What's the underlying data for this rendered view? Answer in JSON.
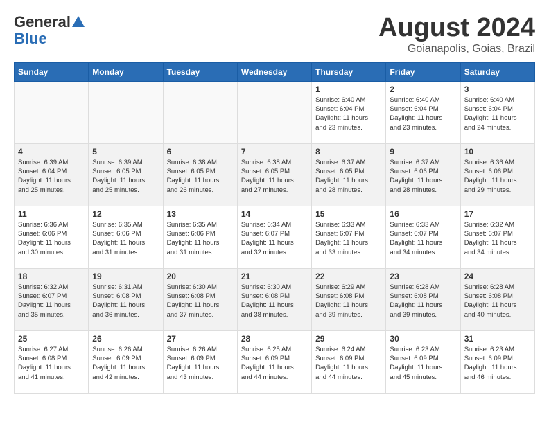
{
  "header": {
    "logo_general": "General",
    "logo_blue": "Blue",
    "month_year": "August 2024",
    "location": "Goianapolis, Goias, Brazil"
  },
  "weekdays": [
    "Sunday",
    "Monday",
    "Tuesday",
    "Wednesday",
    "Thursday",
    "Friday",
    "Saturday"
  ],
  "weeks": [
    [
      {
        "day": "",
        "info": ""
      },
      {
        "day": "",
        "info": ""
      },
      {
        "day": "",
        "info": ""
      },
      {
        "day": "",
        "info": ""
      },
      {
        "day": "1",
        "info": "Sunrise: 6:40 AM\nSunset: 6:04 PM\nDaylight: 11 hours\nand 23 minutes."
      },
      {
        "day": "2",
        "info": "Sunrise: 6:40 AM\nSunset: 6:04 PM\nDaylight: 11 hours\nand 23 minutes."
      },
      {
        "day": "3",
        "info": "Sunrise: 6:40 AM\nSunset: 6:04 PM\nDaylight: 11 hours\nand 24 minutes."
      }
    ],
    [
      {
        "day": "4",
        "info": "Sunrise: 6:39 AM\nSunset: 6:04 PM\nDaylight: 11 hours\nand 25 minutes."
      },
      {
        "day": "5",
        "info": "Sunrise: 6:39 AM\nSunset: 6:05 PM\nDaylight: 11 hours\nand 25 minutes."
      },
      {
        "day": "6",
        "info": "Sunrise: 6:38 AM\nSunset: 6:05 PM\nDaylight: 11 hours\nand 26 minutes."
      },
      {
        "day": "7",
        "info": "Sunrise: 6:38 AM\nSunset: 6:05 PM\nDaylight: 11 hours\nand 27 minutes."
      },
      {
        "day": "8",
        "info": "Sunrise: 6:37 AM\nSunset: 6:05 PM\nDaylight: 11 hours\nand 28 minutes."
      },
      {
        "day": "9",
        "info": "Sunrise: 6:37 AM\nSunset: 6:06 PM\nDaylight: 11 hours\nand 28 minutes."
      },
      {
        "day": "10",
        "info": "Sunrise: 6:36 AM\nSunset: 6:06 PM\nDaylight: 11 hours\nand 29 minutes."
      }
    ],
    [
      {
        "day": "11",
        "info": "Sunrise: 6:36 AM\nSunset: 6:06 PM\nDaylight: 11 hours\nand 30 minutes."
      },
      {
        "day": "12",
        "info": "Sunrise: 6:35 AM\nSunset: 6:06 PM\nDaylight: 11 hours\nand 31 minutes."
      },
      {
        "day": "13",
        "info": "Sunrise: 6:35 AM\nSunset: 6:06 PM\nDaylight: 11 hours\nand 31 minutes."
      },
      {
        "day": "14",
        "info": "Sunrise: 6:34 AM\nSunset: 6:07 PM\nDaylight: 11 hours\nand 32 minutes."
      },
      {
        "day": "15",
        "info": "Sunrise: 6:33 AM\nSunset: 6:07 PM\nDaylight: 11 hours\nand 33 minutes."
      },
      {
        "day": "16",
        "info": "Sunrise: 6:33 AM\nSunset: 6:07 PM\nDaylight: 11 hours\nand 34 minutes."
      },
      {
        "day": "17",
        "info": "Sunrise: 6:32 AM\nSunset: 6:07 PM\nDaylight: 11 hours\nand 34 minutes."
      }
    ],
    [
      {
        "day": "18",
        "info": "Sunrise: 6:32 AM\nSunset: 6:07 PM\nDaylight: 11 hours\nand 35 minutes."
      },
      {
        "day": "19",
        "info": "Sunrise: 6:31 AM\nSunset: 6:08 PM\nDaylight: 11 hours\nand 36 minutes."
      },
      {
        "day": "20",
        "info": "Sunrise: 6:30 AM\nSunset: 6:08 PM\nDaylight: 11 hours\nand 37 minutes."
      },
      {
        "day": "21",
        "info": "Sunrise: 6:30 AM\nSunset: 6:08 PM\nDaylight: 11 hours\nand 38 minutes."
      },
      {
        "day": "22",
        "info": "Sunrise: 6:29 AM\nSunset: 6:08 PM\nDaylight: 11 hours\nand 39 minutes."
      },
      {
        "day": "23",
        "info": "Sunrise: 6:28 AM\nSunset: 6:08 PM\nDaylight: 11 hours\nand 39 minutes."
      },
      {
        "day": "24",
        "info": "Sunrise: 6:28 AM\nSunset: 6:08 PM\nDaylight: 11 hours\nand 40 minutes."
      }
    ],
    [
      {
        "day": "25",
        "info": "Sunrise: 6:27 AM\nSunset: 6:08 PM\nDaylight: 11 hours\nand 41 minutes."
      },
      {
        "day": "26",
        "info": "Sunrise: 6:26 AM\nSunset: 6:09 PM\nDaylight: 11 hours\nand 42 minutes."
      },
      {
        "day": "27",
        "info": "Sunrise: 6:26 AM\nSunset: 6:09 PM\nDaylight: 11 hours\nand 43 minutes."
      },
      {
        "day": "28",
        "info": "Sunrise: 6:25 AM\nSunset: 6:09 PM\nDaylight: 11 hours\nand 44 minutes."
      },
      {
        "day": "29",
        "info": "Sunrise: 6:24 AM\nSunset: 6:09 PM\nDaylight: 11 hours\nand 44 minutes."
      },
      {
        "day": "30",
        "info": "Sunrise: 6:23 AM\nSunset: 6:09 PM\nDaylight: 11 hours\nand 45 minutes."
      },
      {
        "day": "31",
        "info": "Sunrise: 6:23 AM\nSunset: 6:09 PM\nDaylight: 11 hours\nand 46 minutes."
      }
    ]
  ]
}
